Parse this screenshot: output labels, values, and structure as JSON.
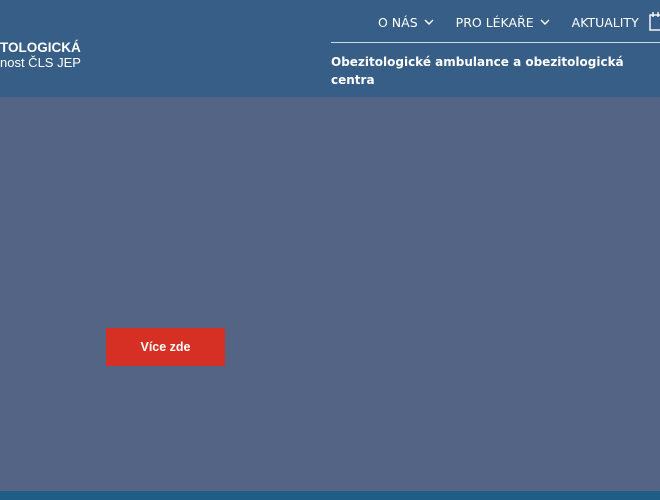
{
  "logo": {
    "line1": "TOLOGICKÁ",
    "line2": "nost ČLS JEP"
  },
  "nav": {
    "items": [
      {
        "label": "O NÁS",
        "has_dropdown": true
      },
      {
        "label": "PRO LÉKAŘE",
        "has_dropdown": true
      },
      {
        "label": "AKTUALITY",
        "has_dropdown": false
      }
    ]
  },
  "subnav": {
    "link": "Obezitologické ambulance a obezitologická centra"
  },
  "hero": {
    "cta_label": "Více zde"
  },
  "colors": {
    "header_bg": "#375e86",
    "hero_bg": "#536485",
    "cta_bg": "#d62f23",
    "footer_bg": "#1f5c86",
    "text": "#ffffff"
  }
}
